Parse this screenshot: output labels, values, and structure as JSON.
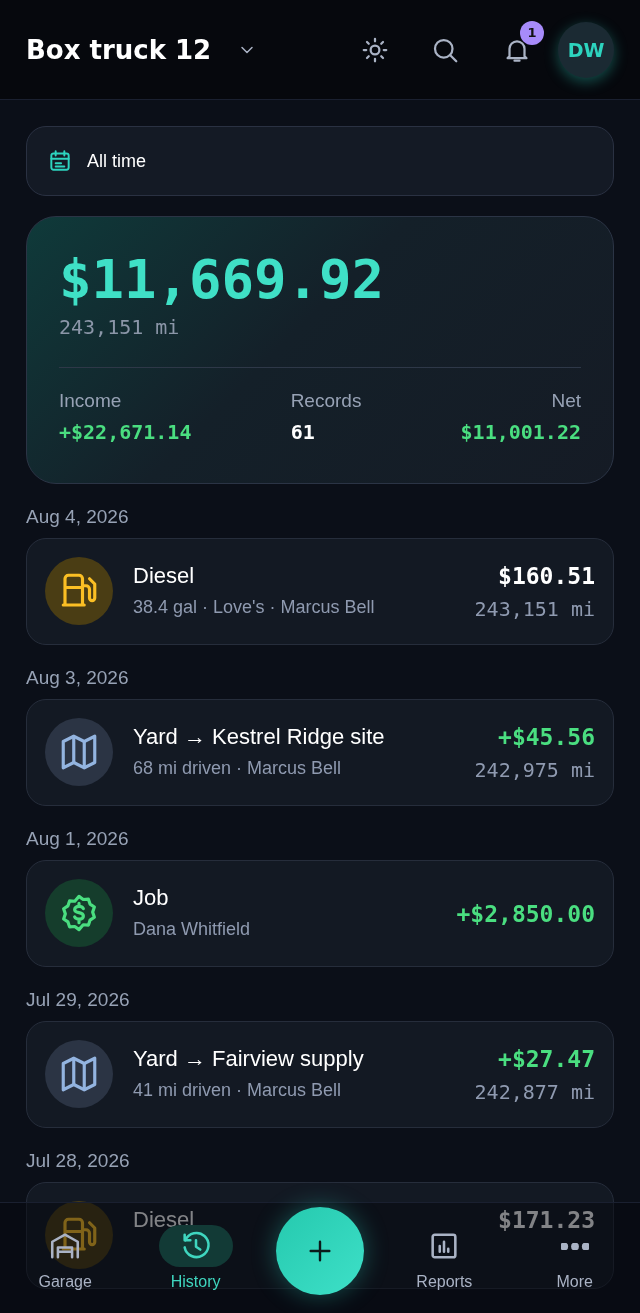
{
  "header": {
    "title": "Box truck 12",
    "notifications": "1",
    "avatar": "DW"
  },
  "filter": {
    "label": "All time"
  },
  "summary": {
    "total": "$11,669.92",
    "odometer": "243,151 mi",
    "stats": [
      {
        "label": "Income",
        "value": "+$22,671.14",
        "positive": true
      },
      {
        "label": "Records",
        "value": "61",
        "positive": false
      },
      {
        "label": "Net",
        "value": "$11,001.22",
        "positive": true
      }
    ]
  },
  "groups": [
    {
      "date": "Aug 4, 2026",
      "entries": [
        {
          "kind": "fuel",
          "title": "Diesel",
          "detail": "38.4 gal · Love's · Marcus Bell",
          "amount": "$160.51",
          "income": false,
          "odometer": "243,151 mi"
        }
      ]
    },
    {
      "date": "Aug 3, 2026",
      "entries": [
        {
          "kind": "trip",
          "title": "Yard → Kestrel Ridge site",
          "detail": "68 mi driven · Marcus Bell",
          "amount": "+$45.56",
          "income": true,
          "odometer": "242,975 mi"
        }
      ]
    },
    {
      "date": "Aug 1, 2026",
      "entries": [
        {
          "kind": "job",
          "title": "Job",
          "detail": "Dana Whitfield",
          "amount": "+$2,850.00",
          "income": true
        }
      ]
    },
    {
      "date": "Jul 29, 2026",
      "entries": [
        {
          "kind": "trip",
          "title": "Yard → Fairview supply",
          "detail": "41 mi driven · Marcus Bell",
          "amount": "+$27.47",
          "income": true,
          "odometer": "242,877 mi"
        }
      ]
    },
    {
      "date": "Jul 28, 2026",
      "entries": [
        {
          "kind": "fuel",
          "title": "Diesel",
          "amount": "$171.23",
          "income": false
        }
      ]
    }
  ],
  "nav": [
    {
      "kind": "garage",
      "label": "Garage",
      "selected": false
    },
    {
      "kind": "history",
      "label": "History",
      "selected": true
    },
    {
      "kind": "add"
    },
    {
      "kind": "reports",
      "label": "Reports",
      "selected": false
    },
    {
      "kind": "more",
      "label": "More",
      "selected": false
    }
  ]
}
